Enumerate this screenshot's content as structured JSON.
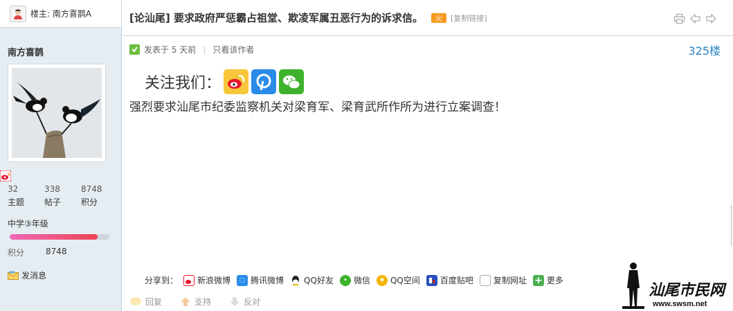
{
  "sidebar": {
    "op_label": "楼主: 南方喜鹊A",
    "author_name": "南方喜鹊",
    "stats": [
      {
        "value": "32",
        "label": "主题"
      },
      {
        "value": "338",
        "label": "帖子"
      },
      {
        "value": "8748",
        "label": "积分"
      }
    ],
    "level": "中学③年级",
    "level_progress": 0.88,
    "points_label": "积分",
    "points_value": "8748",
    "send_message": "发消息"
  },
  "thread": {
    "category": "[论汕尾]",
    "title": "要求政府严惩霸占祖堂、欺凌军属丑恶行为的诉求信。",
    "hot_badge": "火",
    "copy_link": "[复制链接]"
  },
  "post": {
    "posted": "发表于 5 天前",
    "only_author": "只看该作者",
    "floor": "325楼",
    "follow_text": "关注我们：",
    "content": "强烈要求汕尾市纪委监察机关对梁育军、梁育武所作所为进行立案调查！"
  },
  "share": {
    "label": "分享到：",
    "items": [
      {
        "name": "新浪微博",
        "icon": "weibo-icon",
        "color": "#e6162d"
      },
      {
        "name": "腾讯微博",
        "icon": "tencent-weibo-icon",
        "color": "#2a8ce8"
      },
      {
        "name": "QQ好友",
        "icon": "qq-icon",
        "color": "#222222"
      },
      {
        "name": "微信",
        "icon": "wechat-icon",
        "color": "#3fb22d"
      },
      {
        "name": "QQ空间",
        "icon": "qzone-icon",
        "color": "#f5b400"
      },
      {
        "name": "百度贴吧",
        "icon": "tieba-icon",
        "color": "#c02a2a"
      },
      {
        "name": "复制网址",
        "icon": "copy-url-icon",
        "color": "#888888"
      },
      {
        "name": "更多",
        "icon": "more-icon",
        "color": "#4caf50"
      }
    ]
  },
  "actions": {
    "reply": "回复",
    "support": "支持",
    "oppose": "反对"
  },
  "watermark": {
    "logo_text": "汕尾市民网",
    "url": "www.swsm.net"
  },
  "colors": {
    "accent": "#2b85c5",
    "sidebar_bg": "#e5edf2",
    "border": "#c2d5e3"
  }
}
